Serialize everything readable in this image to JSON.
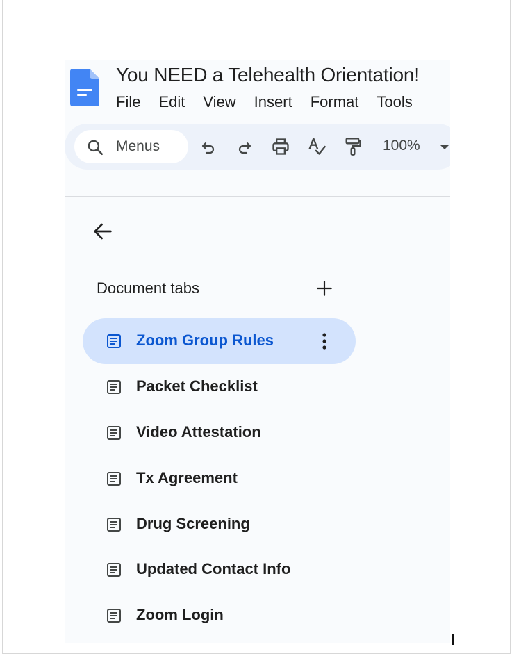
{
  "document": {
    "title": "You NEED a Telehealth Orientation!"
  },
  "menu": [
    "File",
    "Edit",
    "View",
    "Insert",
    "Format",
    "Tools"
  ],
  "toolbar": {
    "search_label": "Menus",
    "zoom": "100%"
  },
  "sidebar": {
    "heading": "Document tabs",
    "tabs": [
      {
        "label": "Zoom Group Rules",
        "active": true
      },
      {
        "label": "Packet Checklist",
        "active": false
      },
      {
        "label": "Video Attestation",
        "active": false
      },
      {
        "label": "Tx Agreement",
        "active": false
      },
      {
        "label": "Drug Screening",
        "active": false
      },
      {
        "label": "Updated Contact Info",
        "active": false
      },
      {
        "label": "Zoom Login",
        "active": false
      }
    ]
  },
  "colors": {
    "accent": "#0b57d0",
    "active_tab_bg": "#d3e3fd",
    "docs_blue": "#4285f4",
    "panel_bg": "#f9fbfd",
    "toolbar_bg": "#edf2fa"
  },
  "icons": {
    "app_logo": "google-docs-icon",
    "search": "search-icon",
    "undo": "undo-icon",
    "redo": "redo-icon",
    "print": "print-icon",
    "spellcheck": "spellcheck-icon",
    "paint_format": "paint-format-icon",
    "back": "arrow-left-icon",
    "add": "plus-icon",
    "tab": "document-tab-icon",
    "more": "more-vert-icon"
  }
}
